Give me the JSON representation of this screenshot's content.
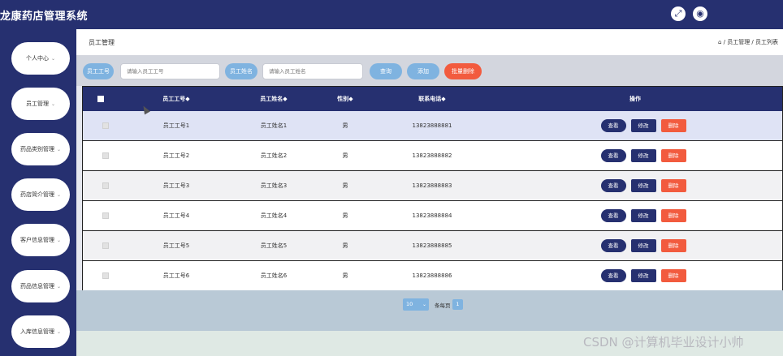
{
  "app": {
    "title": "龙康药店管理系统"
  },
  "header": {
    "icons": [
      "fullscreen-icon",
      "user-icon"
    ]
  },
  "sidebar": {
    "items": [
      {
        "label": "个人中心"
      },
      {
        "label": "员工管理"
      },
      {
        "label": "药品类别管理"
      },
      {
        "label": "药店简介管理"
      },
      {
        "label": "客户信息管理"
      },
      {
        "label": "药品信息管理"
      },
      {
        "label": "入库信息管理"
      }
    ],
    "caret": "⌄"
  },
  "page": {
    "title": "员工管理",
    "breadcrumb": "⌂ / 员工管理 / 员工列表"
  },
  "search": {
    "id_label": "员工工号",
    "id_placeholder": "请输入员工工号",
    "name_label": "员工姓名",
    "name_placeholder": "请输入员工姓名",
    "query_button": "查询",
    "add_button": "添加",
    "batch_delete_button": "批量删除"
  },
  "table": {
    "headers": {
      "id": "员工工号◆",
      "name": "员工姓名◆",
      "gender": "性别◆",
      "phone": "联系电话◆",
      "actions": "操作"
    },
    "rows": [
      {
        "id": "员工工号1",
        "name": "员工姓名1",
        "gender": "男",
        "phone": "13823888881"
      },
      {
        "id": "员工工号2",
        "name": "员工姓名2",
        "gender": "男",
        "phone": "13823888882"
      },
      {
        "id": "员工工号3",
        "name": "员工姓名3",
        "gender": "男",
        "phone": "13823888883"
      },
      {
        "id": "员工工号4",
        "name": "员工姓名4",
        "gender": "男",
        "phone": "13823888884"
      },
      {
        "id": "员工工号5",
        "name": "员工姓名5",
        "gender": "男",
        "phone": "13823888885"
      },
      {
        "id": "员工工号6",
        "name": "员工姓名6",
        "gender": "男",
        "phone": "13823888886"
      }
    ],
    "actions": {
      "view": "查看",
      "edit": "修改",
      "delete": "删除"
    }
  },
  "pagination": {
    "page_size": "10",
    "per_page_label": "条每页",
    "current_page": "1"
  },
  "watermark": "CSDN @计算机毕业设计小帅",
  "colors": {
    "navy": "#263070",
    "light_blue": "#7fb3e0",
    "red": "#f25b3e"
  }
}
